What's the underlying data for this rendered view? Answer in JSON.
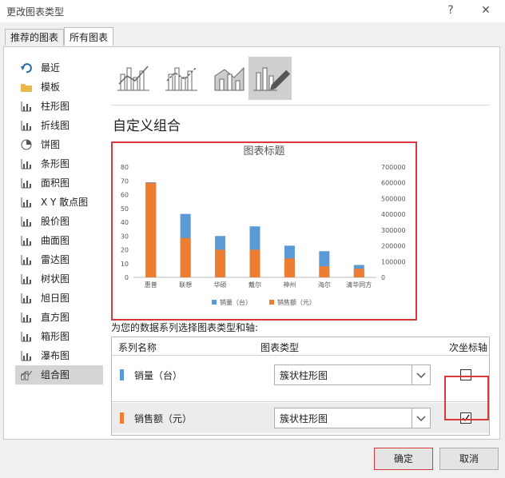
{
  "window": {
    "title": "更改图表类型",
    "help": "?",
    "close": "✕"
  },
  "tabs": [
    {
      "label": "推荐的图表"
    },
    {
      "label": "所有图表"
    }
  ],
  "sidebar": {
    "items": [
      {
        "label": "最近",
        "icon": "undo-icon"
      },
      {
        "label": "模板",
        "icon": "folder-icon"
      },
      {
        "label": "柱形图",
        "icon": "column-chart-icon"
      },
      {
        "label": "折线图",
        "icon": "line-chart-icon"
      },
      {
        "label": "饼图",
        "icon": "pie-chart-icon"
      },
      {
        "label": "条形图",
        "icon": "bar-chart-icon"
      },
      {
        "label": "面积图",
        "icon": "area-chart-icon"
      },
      {
        "label": "X Y 散点图",
        "icon": "scatter-chart-icon"
      },
      {
        "label": "股价图",
        "icon": "stock-chart-icon"
      },
      {
        "label": "曲面图",
        "icon": "surface-chart-icon"
      },
      {
        "label": "雷达图",
        "icon": "radar-chart-icon"
      },
      {
        "label": "树状图",
        "icon": "treemap-chart-icon"
      },
      {
        "label": "旭日图",
        "icon": "sunburst-chart-icon"
      },
      {
        "label": "直方图",
        "icon": "histogram-chart-icon"
      },
      {
        "label": "箱形图",
        "icon": "boxwhisker-chart-icon"
      },
      {
        "label": "瀑布图",
        "icon": "waterfall-chart-icon"
      },
      {
        "label": "组合图",
        "icon": "combo-chart-icon"
      }
    ]
  },
  "main": {
    "section_title": "自定义组合",
    "series_prompt": "为您的数据系列选择图表类型和轴:",
    "headers": {
      "name": "系列名称",
      "type": "图表类型",
      "secondary": "次坐标轴"
    },
    "series": [
      {
        "name": "销量（台）",
        "chart_type": "簇状柱形图",
        "secondary_axis": false,
        "color": "#5b9bd5"
      },
      {
        "name": "销售额（元）",
        "chart_type": "簇状柱形图",
        "secondary_axis": true,
        "color": "#ed7d31"
      }
    ]
  },
  "buttons": {
    "ok": "确定",
    "cancel": "取消"
  },
  "chart_data": {
    "type": "bar",
    "title": "图表标题",
    "categories": [
      "惠普",
      "联想",
      "华硕",
      "戴尔",
      "神州",
      "海尔",
      "清华同方"
    ],
    "series": [
      {
        "name": "销量（台）",
        "axis": "primary",
        "color": "#5b9bd5",
        "values": [
          69,
          46,
          30,
          37,
          23,
          19,
          9
        ]
      },
      {
        "name": "销售额（元）",
        "axis": "secondary",
        "color": "#ed7d31",
        "values": [
          600000,
          250000,
          175000,
          175000,
          120000,
          70000,
          55000
        ]
      }
    ],
    "ylim": [
      0,
      80
    ],
    "y_ticks": [
      "0",
      "10",
      "20",
      "30",
      "40",
      "50",
      "60",
      "70",
      "80"
    ],
    "y2lim": [
      0,
      700000
    ],
    "y2_ticks": [
      "0",
      "100000",
      "200000",
      "300000",
      "400000",
      "500000",
      "600000",
      "700000"
    ],
    "legend": "bottom",
    "grid": false
  }
}
